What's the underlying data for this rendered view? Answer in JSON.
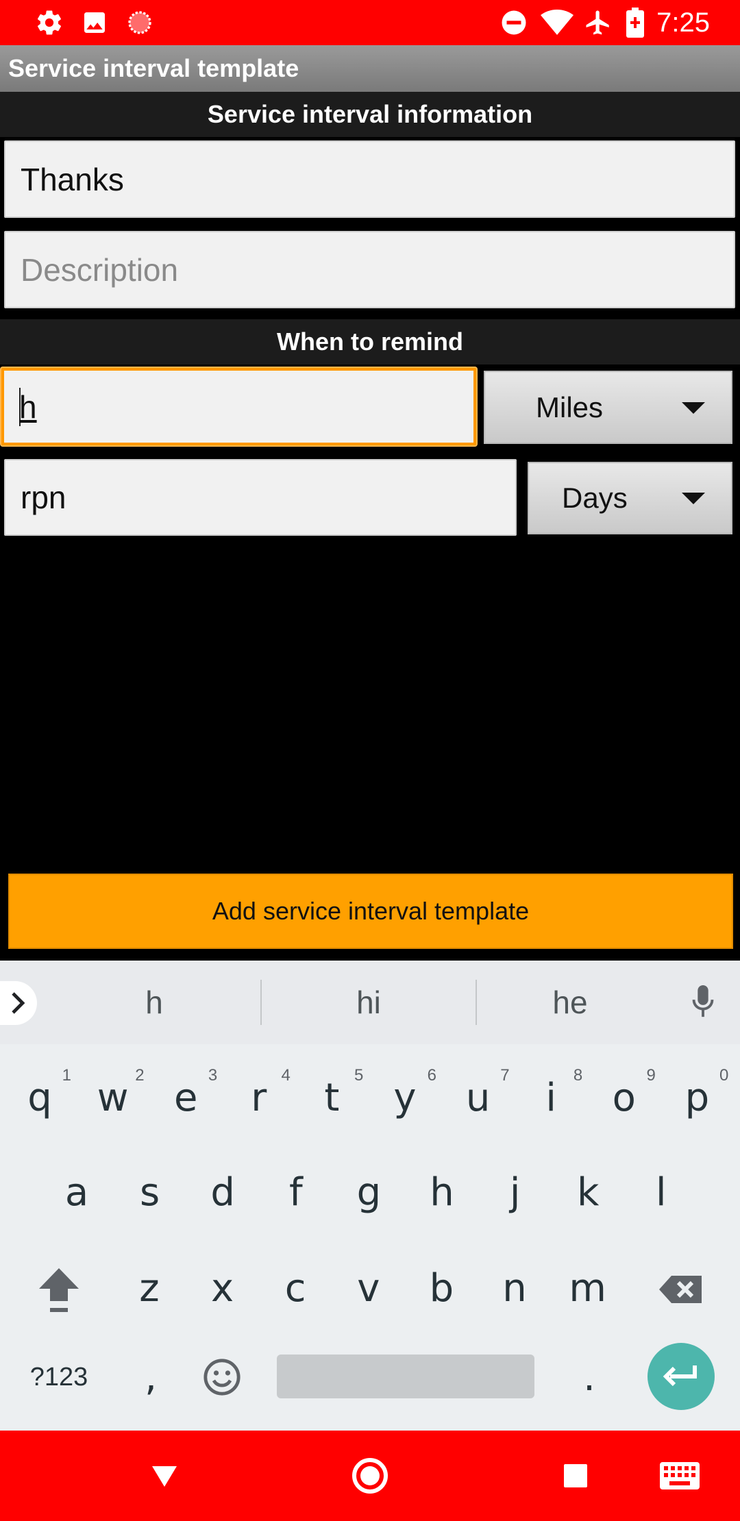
{
  "status_bar": {
    "time": "7:25",
    "left_icons": [
      "gear-icon",
      "image-icon",
      "record-icon"
    ],
    "right_icons": [
      "do-not-disturb-icon",
      "wifi-icon",
      "airplane-icon",
      "battery-charging-icon"
    ]
  },
  "title_bar": {
    "title": "Service interval template"
  },
  "sections": {
    "info_header": "Service interval information",
    "remind_header": "When to remind"
  },
  "form": {
    "name_value": "Thanks",
    "description_placeholder": "Description",
    "distance_value": "h",
    "distance_unit": "Miles",
    "time_value": "rpn",
    "time_unit": "Days"
  },
  "add_button_label": "Add service interval template",
  "keyboard": {
    "suggestions": [
      "h",
      "hi",
      "he"
    ],
    "row1": [
      {
        "k": "q",
        "n": "1"
      },
      {
        "k": "w",
        "n": "2"
      },
      {
        "k": "e",
        "n": "3"
      },
      {
        "k": "r",
        "n": "4"
      },
      {
        "k": "t",
        "n": "5"
      },
      {
        "k": "y",
        "n": "6"
      },
      {
        "k": "u",
        "n": "7"
      },
      {
        "k": "i",
        "n": "8"
      },
      {
        "k": "o",
        "n": "9"
      },
      {
        "k": "p",
        "n": "0"
      }
    ],
    "row2": [
      "a",
      "s",
      "d",
      "f",
      "g",
      "h",
      "j",
      "k",
      "l"
    ],
    "row3": [
      "z",
      "x",
      "c",
      "v",
      "b",
      "n",
      "m"
    ],
    "symbols_label": "?123",
    "comma": ",",
    "period": "."
  },
  "nav_bar": {
    "icons": [
      "back-icon",
      "home-icon",
      "recents-icon",
      "keyboard-switch-icon"
    ]
  },
  "colors": {
    "status_bar": "#ff0000",
    "accent": "#ffa000",
    "focus": "#ff9800",
    "enter_key": "#4db6ac"
  }
}
